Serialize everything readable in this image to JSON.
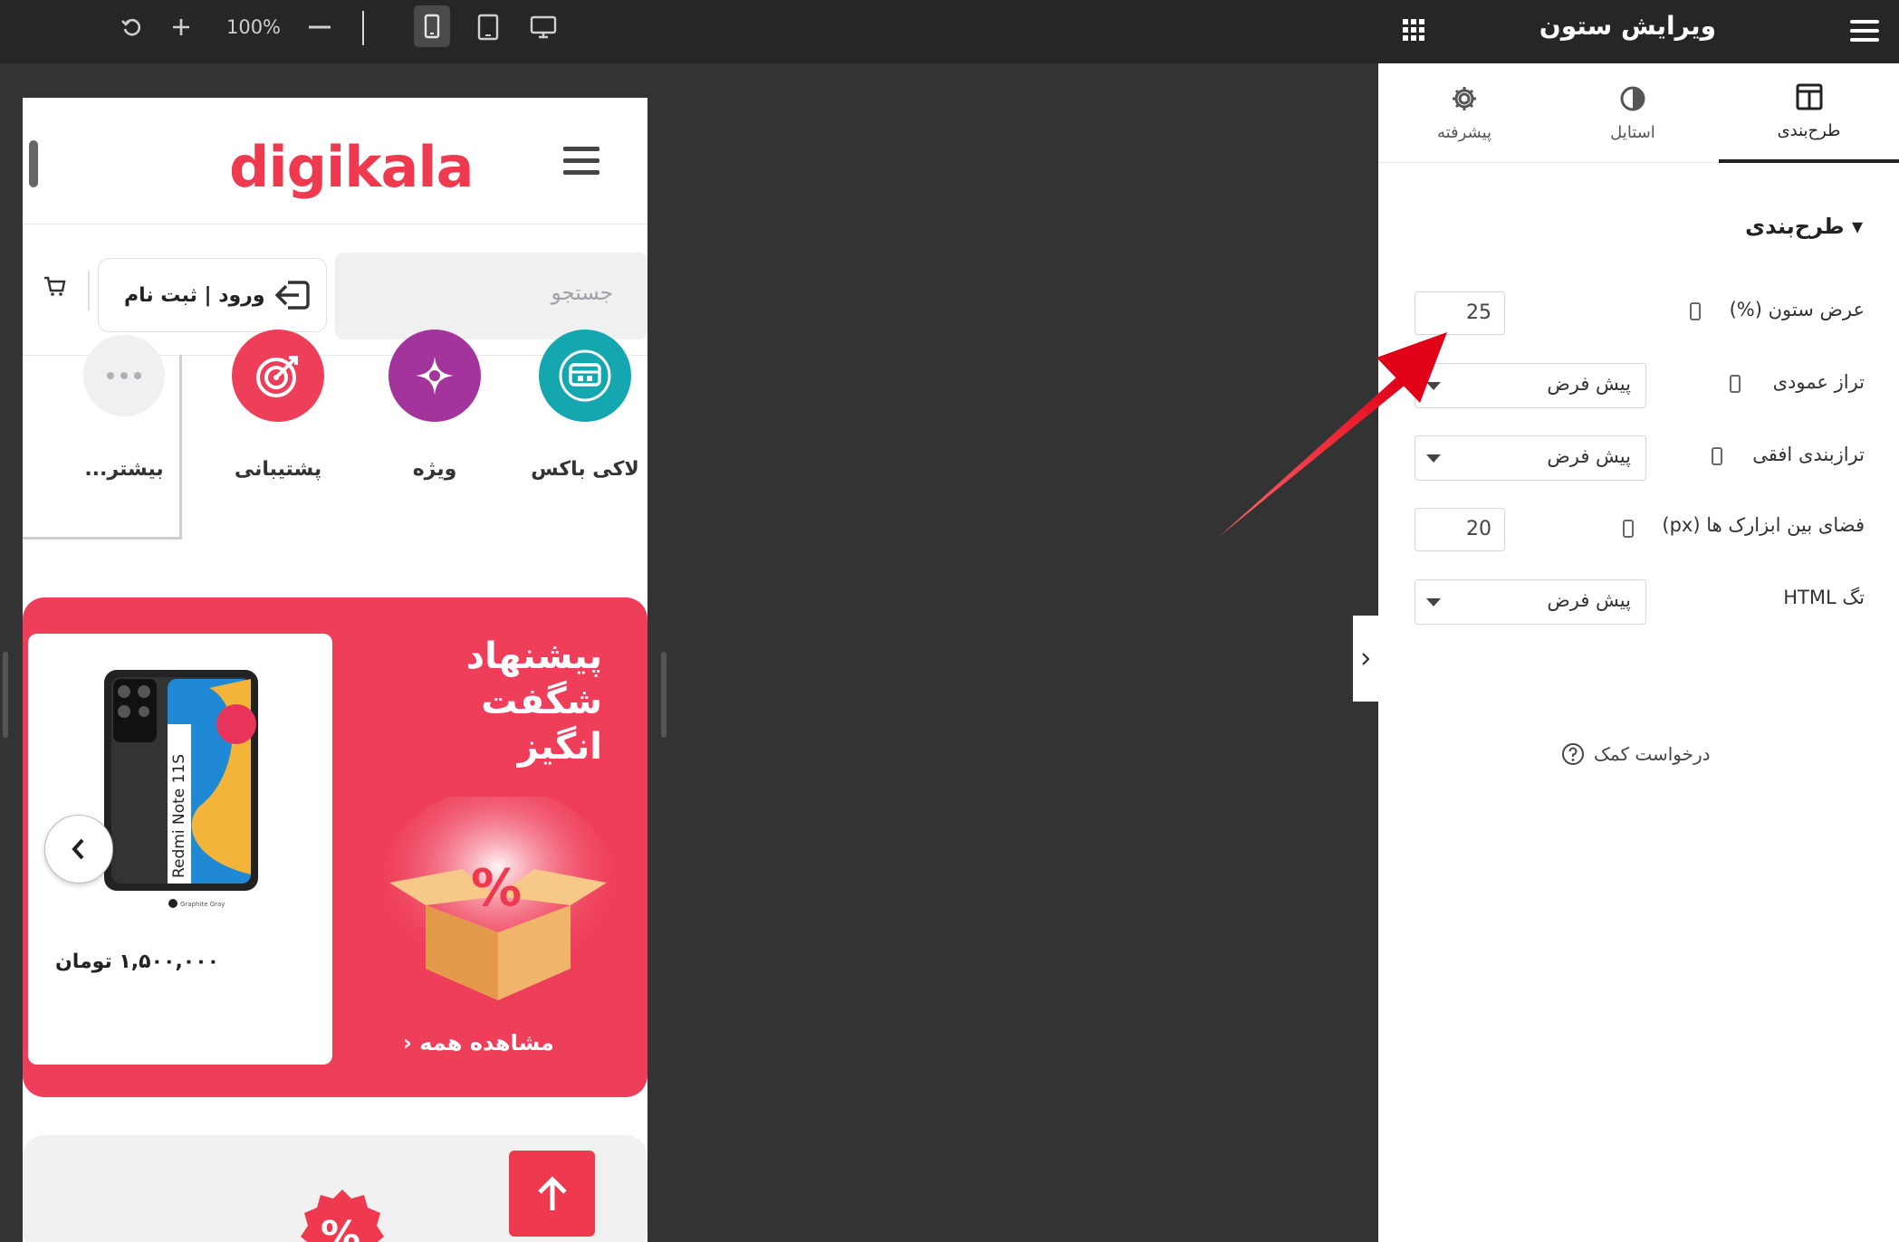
{
  "toolbar": {
    "zoom": "100%",
    "undo_icon": "undo-icon",
    "zoom_in_icon": "plus-icon",
    "zoom_out_icon": "minus-icon",
    "devices": [
      "mobile",
      "tablet",
      "desktop"
    ],
    "active_device": "mobile"
  },
  "preview": {
    "logo": "digikala",
    "search_placeholder": "جستجو",
    "login_label": "ورود | ثبت نام",
    "categories": [
      {
        "label": "لاکی باکس",
        "color": "#15a7b0"
      },
      {
        "label": "ویژه",
        "color": "#a3349b"
      },
      {
        "label": "پشتیبانی",
        "color": "#ef3e59"
      },
      {
        "label": "بیشتر...",
        "color": "#f0f0f1"
      }
    ],
    "promo": {
      "title_line1": "پیشنهاد",
      "title_line2": "شگفت",
      "title_line3": "انگیز",
      "see_all": "مشاهده همه",
      "product_model": "Redmi Note 11S",
      "product_color": "Graphite Gray",
      "price": "۱,۵۰۰,۰۰۰ تومان",
      "badge": "%",
      "bg_color": "#ef3e59"
    }
  },
  "panel": {
    "title": "ویرایش ستون",
    "tabs": [
      {
        "label": "طرح‌بندی",
        "icon": "layout-icon",
        "active": true
      },
      {
        "label": "استایل",
        "icon": "contrast-icon",
        "active": false
      },
      {
        "label": "پیشرفته",
        "icon": "gear-icon",
        "active": false
      }
    ],
    "section": "طرح‌بندی",
    "fields": {
      "column_width_label": "عرض ستون (%)",
      "column_width_value": "25",
      "vertical_align_label": "تراز عمودی",
      "vertical_align_value": "پیش فرض",
      "horizontal_align_label": "ترازبندی افقی",
      "horizontal_align_value": "پیش فرض",
      "widget_space_label": "فضای بین ابزارک ها (px)",
      "widget_space_value": "20",
      "html_tag_label": "تگ HTML",
      "html_tag_value": "پیش فرض"
    },
    "help": "درخواست کمک"
  }
}
